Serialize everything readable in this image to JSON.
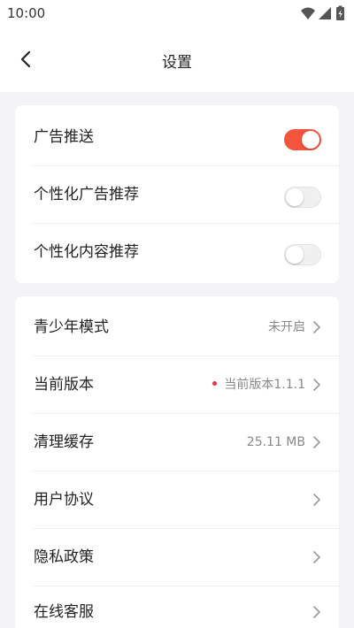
{
  "status_bar": {
    "time": "10:00",
    "icons": [
      "wifi-icon",
      "signal-icon",
      "battery-charging-icon"
    ]
  },
  "header": {
    "back_icon": "chevron-left-icon",
    "title": "设置"
  },
  "ad_section": {
    "items": [
      {
        "label": "广告推送",
        "toggle_on": true
      },
      {
        "label": "个性化广告推荐",
        "toggle_on": false
      },
      {
        "label": "个性化内容推荐",
        "toggle_on": false
      }
    ]
  },
  "general_section": {
    "items": [
      {
        "label": "青少年模式",
        "value": "未开启"
      },
      {
        "label": "当前版本",
        "value": "当前版本1.1.1",
        "has_dot": true
      },
      {
        "label": "清理缓存",
        "value": "25.11 MB"
      },
      {
        "label": "用户协议",
        "value": ""
      },
      {
        "label": "隐私政策",
        "value": ""
      },
      {
        "label": "在线客服",
        "value": ""
      }
    ]
  },
  "colors": {
    "accent": "#f2543d",
    "dot": "#e8334a",
    "background": "#f4f4f6"
  }
}
